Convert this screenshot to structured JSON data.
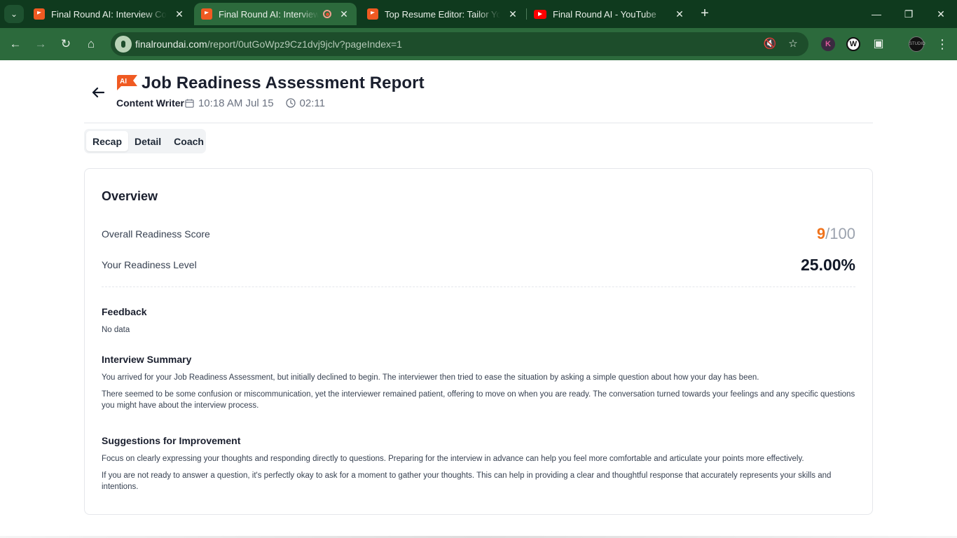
{
  "browser": {
    "tabs": [
      {
        "title": "Final Round AI: Interview Copilot",
        "active": false,
        "favicon": "finalround-flag-icon"
      },
      {
        "title": "Final Round AI: Interview Copilot",
        "active": true,
        "favicon": "finalround-flag-icon"
      },
      {
        "title": "Top Resume Editor: Tailor Your Resume",
        "active": false,
        "favicon": "finalround-flag-icon"
      },
      {
        "title": "Final Round AI - YouTube",
        "active": false,
        "favicon": "youtube-icon"
      }
    ],
    "url": {
      "host": "finalroundai.com",
      "path": "/report/0utGoWpz9Cz1dvj9jclv?pageIndex=1"
    },
    "profile_text": "STUDIO"
  },
  "header": {
    "logo_text": "AI",
    "title": "Job Readiness Assessment Report",
    "role": "Content Writer",
    "datetime": "10:18 AM Jul 15",
    "duration": "02:11"
  },
  "tabs": [
    {
      "label": "Recap",
      "active": true
    },
    {
      "label": "Detail",
      "active": false
    },
    {
      "label": "Coach",
      "active": false
    }
  ],
  "overview": {
    "title": "Overview",
    "score_label": "Overall Readiness Score",
    "score": "9",
    "score_max": "/100",
    "level_label": "Your Readiness Level",
    "level": "25.00%"
  },
  "feedback": {
    "heading": "Feedback",
    "text": "No data"
  },
  "summary": {
    "heading": "Interview Summary",
    "p1": "You arrived for your Job Readiness Assessment, but initially declined to begin. The interviewer then tried to ease the situation by asking a simple question about how your day has been.",
    "p2": "There seemed to be some confusion or miscommunication, yet the interviewer remained patient, offering to move on when you are ready. The conversation turned towards your feelings and any specific questions you might have about the interview process."
  },
  "suggestions": {
    "heading": "Suggestions for Improvement",
    "p1": "Focus on clearly expressing your thoughts and responding directly to questions. Preparing for the interview in advance can help you feel more comfortable and articulate your points more effectively.",
    "p2": "If you are not ready to answer a question, it's perfectly okay to ask for a moment to gather your thoughts. This can help in providing a clear and thoughtful response that accurately represents your skills and intentions."
  },
  "colors": {
    "accent": "#f0731c",
    "browser_frame": "#0f3a1e",
    "browser_toolbar": "#2c6a3c"
  }
}
